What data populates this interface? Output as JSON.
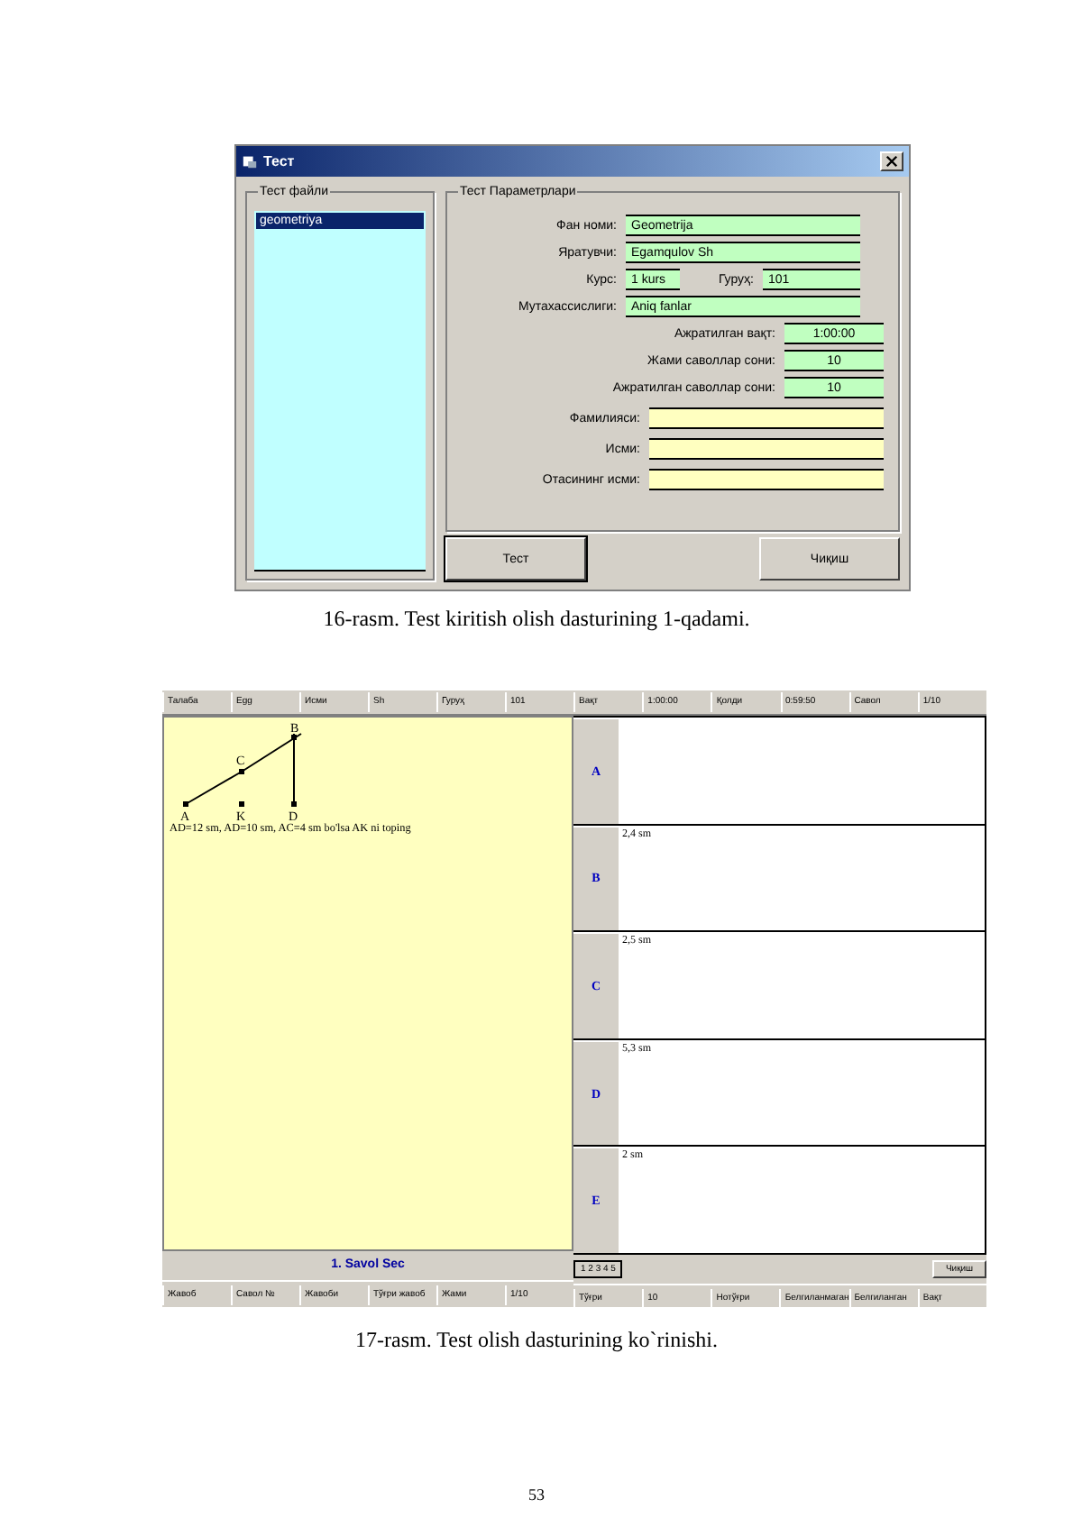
{
  "figure_16": {
    "window": {
      "title": "Тест"
    },
    "file_group": {
      "title": "Тест файли",
      "items": [
        {
          "label": "geometriya",
          "selected": true
        }
      ]
    },
    "params_group": {
      "title": "Тест Параметрлари",
      "rows": [
        {
          "kind": "wide",
          "label": "Фан номи:",
          "value": "Geometrija"
        },
        {
          "kind": "wide",
          "label": "Яратувчи:",
          "value": "Egamqulov Sh"
        },
        {
          "kind": "pair",
          "label": "Курс:",
          "value": "1 kurs",
          "label2": "Гуруҳ:",
          "value2": "101"
        },
        {
          "kind": "wide",
          "label": "Мутахассислиги:",
          "value": "Aniq fanlar"
        },
        {
          "kind": "short",
          "label": "Ажратилган вақт:",
          "value": "1:00:00"
        },
        {
          "kind": "short",
          "label": "Жами саволлар сони:",
          "value": "10"
        },
        {
          "kind": "short",
          "label": "Ажратилган саволлар сони:",
          "value": "10"
        },
        {
          "kind": "input",
          "label": "Фамилияси:"
        },
        {
          "kind": "input",
          "label": "Исми:"
        },
        {
          "kind": "input",
          "label": "Отасининг исми:"
        }
      ]
    },
    "buttons": [
      "Тест",
      "Чиқиш"
    ]
  },
  "caption_16": "16-rasm. Test kiritish olish dasturining 1-qadami.",
  "figure_17": {
    "left_header": [
      "Талаба",
      "Egg",
      "Исми",
      "Sh",
      "Гуруҳ",
      "101"
    ],
    "figure_labels": [
      "A",
      "K",
      "D",
      "C",
      "B"
    ],
    "question": "AD=12 sm, AD=10 sm, AC=4 sm bo'lsa AK ni toping",
    "question_title": "1. Savol Sec",
    "left_status": [
      "Жавоб",
      "Савол №",
      "Жавоби",
      "Тўғри жавоб",
      "Жами",
      "1/10"
    ],
    "right_header": [
      "Вақт",
      "1:00:00",
      "Қолди",
      "0:59:50",
      "Савол",
      "1/10"
    ],
    "answers": [
      {
        "letter": "A"
      },
      {
        "letter": "B",
        "text": "2,4 sm"
      },
      {
        "letter": "C",
        "text": "2,5 sm"
      },
      {
        "letter": "D",
        "text": "5,3 sm"
      },
      {
        "letter": "E",
        "text": "2 sm"
      }
    ],
    "nav_buttons": [
      "1 2 3 4 5"
    ],
    "exit_button": "Чиқиш",
    "right_status": [
      "Тўғри",
      "10",
      "Нотўғри",
      "Белгиланмаган",
      "Белгиланган",
      "Вақт"
    ]
  },
  "caption_17": "17-rasm. Test olish dasturining ko`rinishi.",
  "page_number": "53"
}
